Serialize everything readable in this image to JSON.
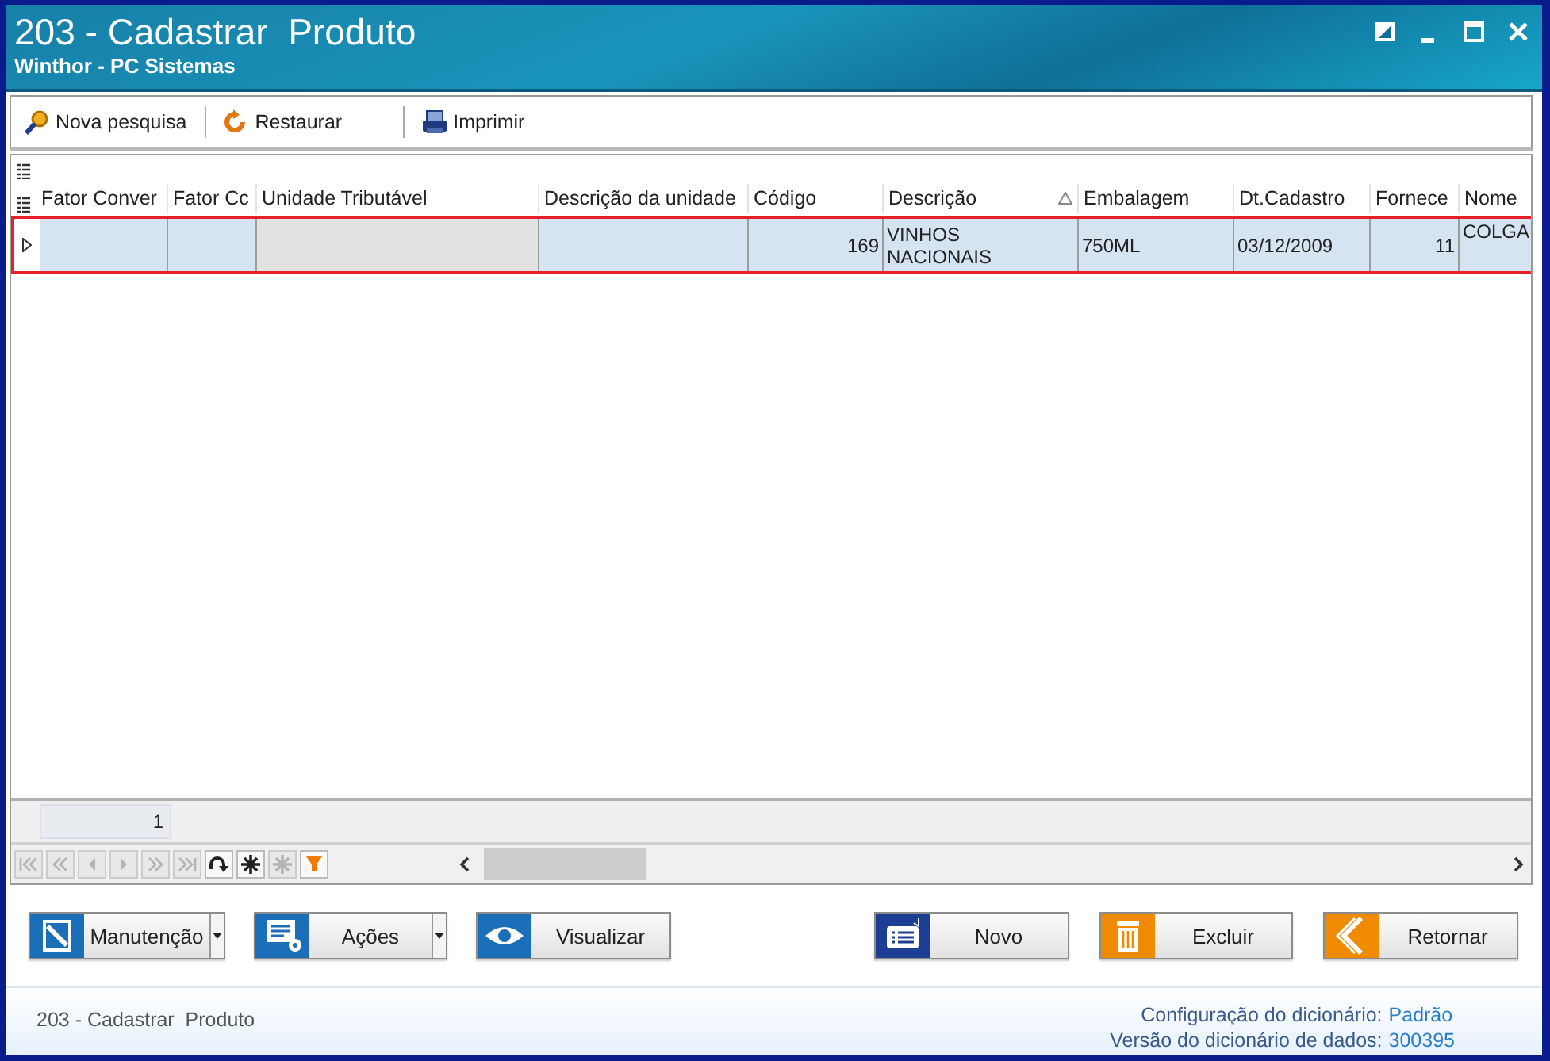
{
  "window": {
    "title": "203 - Cadastrar  Produto",
    "subtitle": "Winthor - PC Sistemas"
  },
  "toolbar": [
    {
      "kind": "search",
      "label": "Nova pesquisa"
    },
    {
      "kind": "restore",
      "label": "Restaurar"
    },
    {
      "kind": "print",
      "label": "Imprimir"
    }
  ],
  "table": {
    "columns": [
      {
        "label": "Fator Conver",
        "kind": "text"
      },
      {
        "label": "Fator Cc",
        "kind": "text"
      },
      {
        "label": "Unidade Tributável",
        "kind": "readonly"
      },
      {
        "label": "Descrição da unidade",
        "kind": "text"
      },
      {
        "label": "Código",
        "kind": "number"
      },
      {
        "label": "Descrição",
        "kind": "text",
        "sorted_ascending": true
      },
      {
        "label": "Embalagem",
        "kind": "text"
      },
      {
        "label": "Dt.Cadastro",
        "kind": "text"
      },
      {
        "label": "Fornece",
        "kind": "number"
      },
      {
        "label": "Nome",
        "kind": "text"
      }
    ],
    "rows": [
      {
        "selected": true,
        "highlighted": true,
        "cells": [
          "",
          "",
          "",
          "",
          "169",
          "VINHOS NACIONAIS",
          "750ML",
          "03/12/2009",
          "11",
          "COLGA"
        ]
      }
    ],
    "footer": [
      "1"
    ]
  },
  "navigator": [
    {
      "kind": "first",
      "disabled": true
    },
    {
      "kind": "prior-page",
      "disabled": true
    },
    {
      "kind": "prior",
      "disabled": true
    },
    {
      "kind": "next",
      "disabled": true
    },
    {
      "kind": "next-page",
      "disabled": true
    },
    {
      "kind": "last",
      "disabled": true
    },
    {
      "kind": "refresh",
      "disabled": false
    },
    {
      "kind": "insert",
      "disabled": false
    },
    {
      "kind": "delete",
      "disabled": true
    },
    {
      "kind": "filter",
      "disabled": false
    }
  ],
  "buttons_left": [
    {
      "kind": "edit",
      "label": "Manutenção",
      "dropdown": true,
      "color": "#1a6fb8"
    },
    {
      "kind": "actions",
      "label": "Ações",
      "dropdown": true,
      "color": "#1a6fb8"
    },
    {
      "kind": "view",
      "label": "Visualizar",
      "dropdown": false,
      "color": "#1a6fb8"
    }
  ],
  "buttons_right": [
    {
      "kind": "new",
      "label": "Novo",
      "dropdown": false,
      "color": "#1c3f94"
    },
    {
      "kind": "delete",
      "label": "Excluir",
      "dropdown": false,
      "color": "#f08a00"
    },
    {
      "kind": "back",
      "label": "Retornar",
      "dropdown": false,
      "color": "#f08a00"
    }
  ],
  "status_bar": {
    "title": "203 - Cadastrar  Produto",
    "info": [
      {
        "label": "Configuração do dicionário:",
        "value": "Padrão"
      },
      {
        "label": "Versão do dicionário de dados:",
        "value": "300395"
      }
    ]
  }
}
